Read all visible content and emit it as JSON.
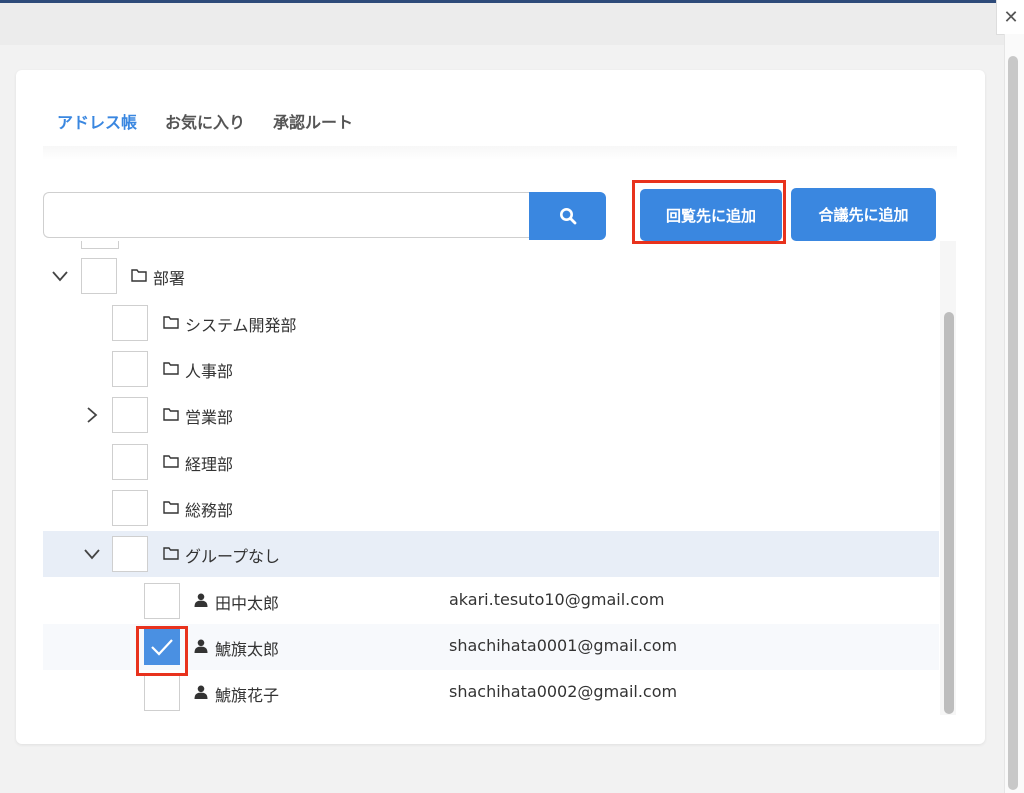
{
  "window": {
    "close_glyph": "✕"
  },
  "tabs": [
    {
      "label": "アドレス帳",
      "active": true
    },
    {
      "label": "お気に入り",
      "active": false
    },
    {
      "label": "承認ルート",
      "active": false
    }
  ],
  "search": {
    "value": "",
    "placeholder": "",
    "icon": "search-icon"
  },
  "buttons": {
    "add_circulation": "回覧先に追加",
    "add_council": "合議先に追加"
  },
  "colors": {
    "accent": "#3a87e0",
    "highlight_border": "#e8321d",
    "selected_row": "#e8eef7"
  },
  "tree": {
    "department_root": {
      "label": "部署",
      "expanded": true
    },
    "departments": [
      {
        "label": "システム開発部",
        "expandable": false
      },
      {
        "label": "人事部",
        "expandable": false
      },
      {
        "label": "営業部",
        "expandable": true
      },
      {
        "label": "経理部",
        "expandable": false
      },
      {
        "label": "総務部",
        "expandable": false
      }
    ],
    "no_group": {
      "label": "グループなし",
      "expanded": true
    },
    "users": [
      {
        "name": "田中太郎",
        "email": "akari.tesuto10@gmail.com",
        "checked": false
      },
      {
        "name": "鯱旗太郎",
        "email": "shachihata0001@gmail.com",
        "checked": true
      },
      {
        "name": "鯱旗花子",
        "email": "shachihata0002@gmail.com",
        "checked": false
      }
    ]
  }
}
